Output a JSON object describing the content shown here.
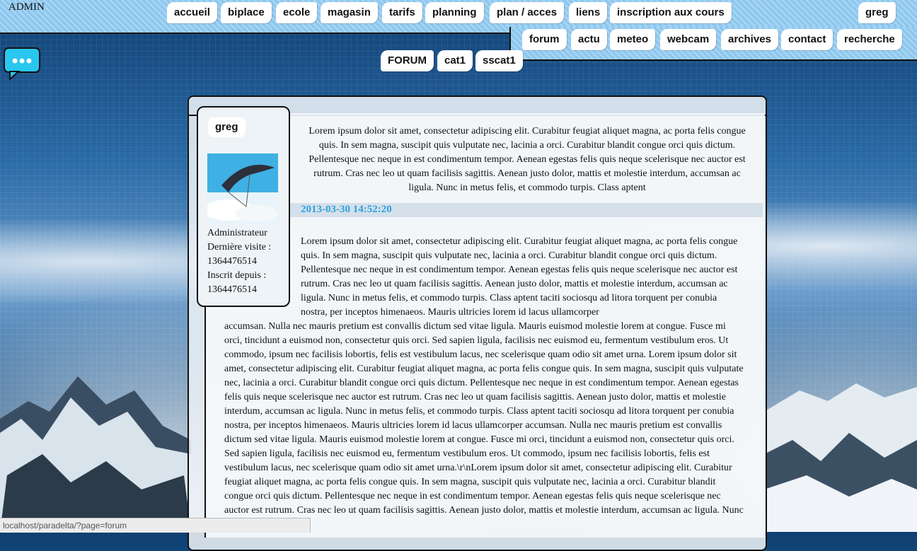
{
  "admin_label": "ADMIN",
  "nav_main": [
    "accueil",
    "biplace",
    "ecole",
    "magasin",
    "tarifs",
    "planning",
    "plan / acces",
    "liens",
    "inscription aux cours"
  ],
  "user_menu": "greg",
  "nav_secondary": [
    "forum",
    "actu",
    "meteo",
    "webcam",
    "archives",
    "contact",
    "recherche"
  ],
  "breadcrumb": [
    "FORUM",
    "cat1",
    "sscat1"
  ],
  "post": {
    "author": "greg",
    "role": "Administrateur",
    "last_visit_label": "Dernière visite :",
    "last_visit_value": "1364476514",
    "member_since_label": "Inscrit depuis :",
    "member_since_value": "1364476514",
    "intro_text": "Lorem ipsum dolor sit amet, consectetur adipiscing elit. Curabitur feugiat aliquet magna, ac porta felis congue quis. In sem magna, suscipit quis vulputate nec, lacinia a orci. Curabitur blandit congue orci quis dictum. Pellentesque nec neque in est condimentum tempor. Aenean egestas felis quis neque scelerisque nec auctor est rutrum. Cras nec leo ut quam facilisis sagittis. Aenean justo dolor, mattis et molestie interdum, accumsan ac ligula. Nunc in metus felis, et commodo turpis. Class aptent",
    "date": "2013-03-30 14:52:20",
    "body_text_a": "Lorem ipsum dolor sit amet, consectetur adipiscing elit. Curabitur feugiat aliquet magna, ac porta felis congue quis. In sem magna, suscipit quis vulputate nec, lacinia a orci. Curabitur blandit congue orci quis dictum. Pellentesque nec neque in est condimentum tempor. Aenean egestas felis quis neque scelerisque nec auctor est rutrum. Cras nec leo ut quam facilisis sagittis. Aenean justo dolor, mattis et molestie interdum, accumsan ac ligula. Nunc in metus felis, et commodo turpis. Class aptent taciti sociosqu ad litora torquent per conubia nostra, per inceptos himenaeos. Mauris ultricies lorem id lacus ullamcorper",
    "body_text_b": "accumsan. Nulla nec mauris pretium est convallis dictum sed vitae ligula. Mauris euismod molestie lorem at congue. Fusce mi orci, tincidunt a euismod non, consectetur quis orci. Sed sapien ligula, facilisis nec euismod eu, fermentum vestibulum eros. Ut commodo, ipsum nec facilisis lobortis, felis est vestibulum lacus, nec scelerisque quam odio sit amet urna. Lorem ipsum dolor sit amet, consectetur adipiscing elit. Curabitur feugiat aliquet magna, ac porta felis congue quis. In sem magna, suscipit quis vulputate nec, lacinia a orci. Curabitur blandit congue orci quis dictum. Pellentesque nec neque in est condimentum tempor. Aenean egestas felis quis neque scelerisque nec auctor est rutrum. Cras nec leo ut quam facilisis sagittis. Aenean justo dolor, mattis et molestie interdum, accumsan ac ligula. Nunc in metus felis, et commodo turpis. Class aptent taciti sociosqu ad litora torquent per conubia nostra, per inceptos himenaeos. Mauris ultricies lorem id lacus ullamcorper accumsan. Nulla nec mauris pretium est convallis dictum sed vitae ligula. Mauris euismod molestie lorem at congue. Fusce mi orci, tincidunt a euismod non, consectetur quis orci. Sed sapien ligula, facilisis nec euismod eu, fermentum vestibulum eros. Ut commodo, ipsum nec facilisis lobortis, felis est vestibulum lacus, nec scelerisque quam odio sit amet urna.\\r\\nLorem ipsum dolor sit amet, consectetur adipiscing elit. Curabitur feugiat aliquet magna, ac porta felis congue quis. In sem magna, suscipit quis vulputate nec, lacinia a orci. Curabitur blandit congue orci quis dictum. Pellentesque nec neque in est condimentum tempor. Aenean egestas felis quis neque scelerisque nec auctor est rutrum. Cras nec leo ut quam facilisis sagittis. Aenean justo dolor, mattis et molestie interdum, accumsan ac ligula. Nunc in metus"
  },
  "status_url": "localhost/paradelta/?page=forum",
  "icons": {
    "chat": "chat-bubble-icon",
    "avatar": "paraglider-avatar"
  },
  "colors": {
    "nav_bg": "#8cc6ee",
    "date": "#2ea3dd"
  }
}
